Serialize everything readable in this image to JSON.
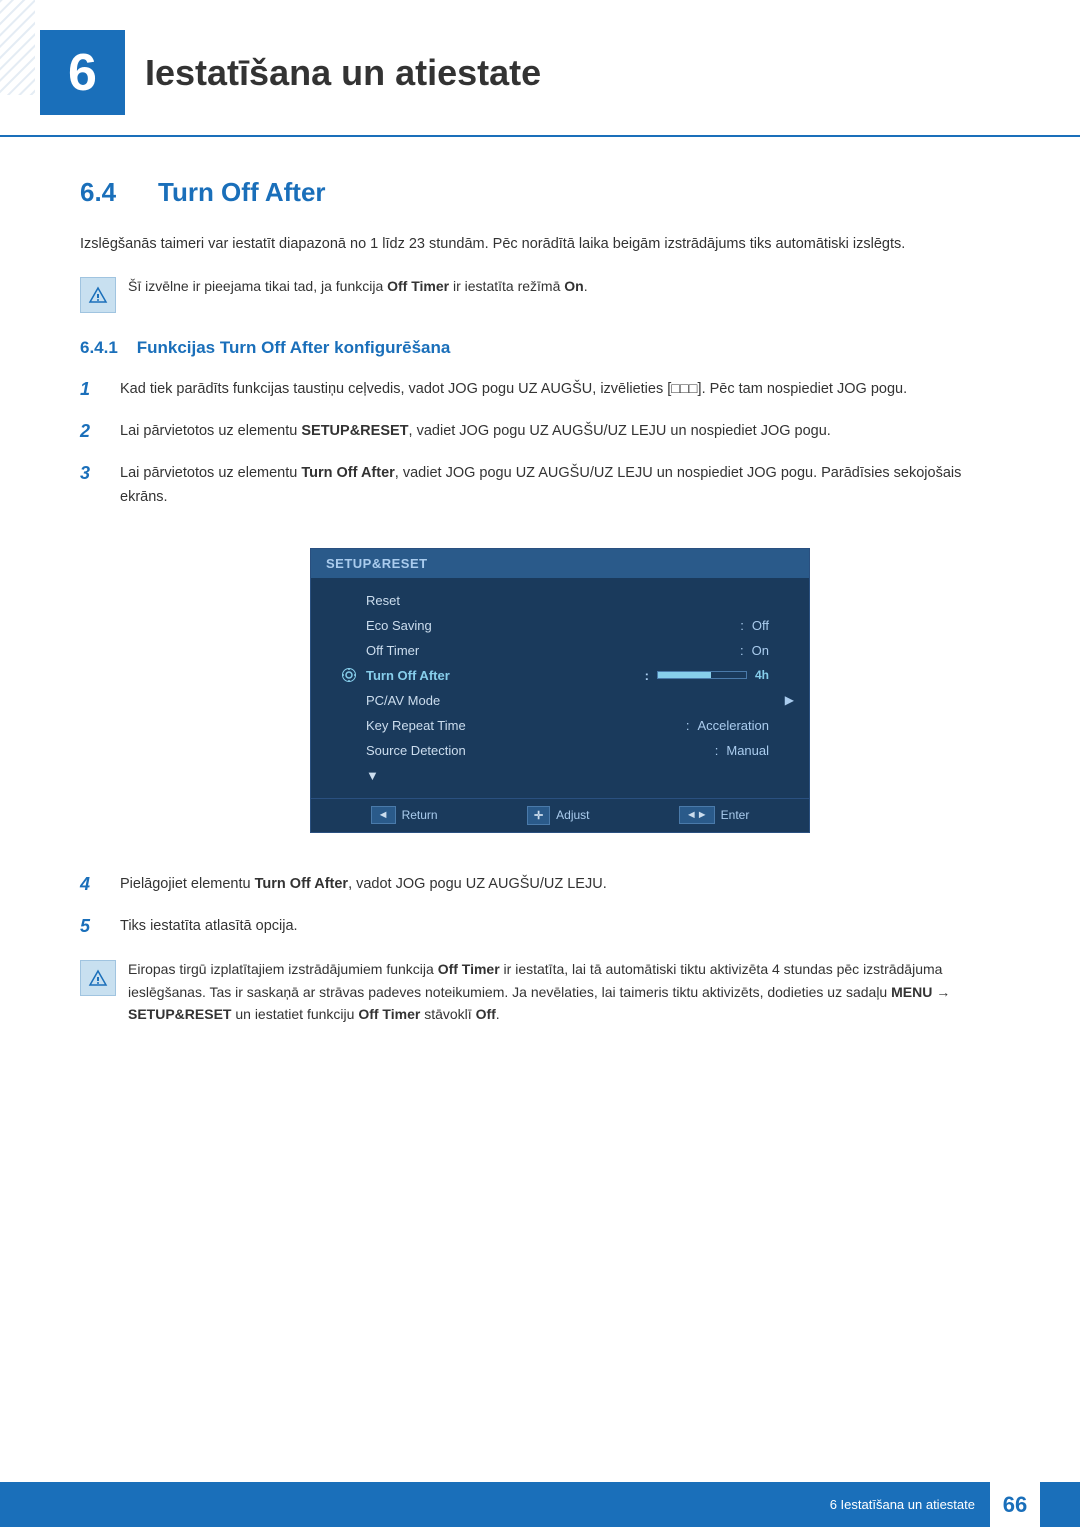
{
  "chapter": {
    "number": "6",
    "title": "Iestatīšana un atiestate"
  },
  "section": {
    "number": "6.4",
    "title": "Turn Off After"
  },
  "body_paragraph": "Izslēgšanās taimeri var iestatīt diapazonā no 1 līdz 23 stundām. Pēc norādītā laika beigām izstrādājums tiks automātiski izslēgts.",
  "note1": {
    "text": "Šī izvēlne ir pieejama tikai tad, ja funkcija Off Timer ir iestatīta režīmā On."
  },
  "subsection": {
    "number": "6.4.1",
    "title": "Funkcijas Turn Off After konfigurēšana"
  },
  "steps": [
    {
      "number": "1",
      "text_before": "Kad tiek parādīts funkcijas taustiņu ceļvedis, vadot JOG pogu UZ AUGŠU, izvēlieties [",
      "icon": "□□□",
      "text_after": "]. Pēc tam nospiediet JOG pogu."
    },
    {
      "number": "2",
      "text_plain": "Lai pārvietotos uz elementu ",
      "bold1": "SETUP&RESET",
      "text_mid": ", vadiet JOG pogu UZ AUGŠU/UZ LEJU un nospiediet JOG pogu."
    },
    {
      "number": "3",
      "text_plain": "Lai pārvietotos uz elementu ",
      "bold1": "Turn Off After",
      "text_mid": ", vadiet JOG pogu UZ AUGŠU/UZ LEJU un nospiediet JOG pogu. Parādīsies sekojošais ekrāns."
    },
    {
      "number": "4",
      "text_plain": "Pielāgojiet elementu ",
      "bold1": "Turn Off After",
      "text_mid": ", vadot JOG pogu UZ AUGŠU/UZ LEJU."
    },
    {
      "number": "5",
      "text_plain": "Tiks iestatīta atlasītā opcija."
    }
  ],
  "menu": {
    "title": "SETUP&RESET",
    "rows": [
      {
        "label": "Reset",
        "value": "",
        "highlighted": false
      },
      {
        "label": "Eco Saving",
        "value": "Off",
        "highlighted": false
      },
      {
        "label": "Off Timer",
        "value": "On",
        "highlighted": false
      },
      {
        "label": "Turn Off After",
        "value": "",
        "highlighted": true,
        "hasProgress": true,
        "progressVal": "4h"
      },
      {
        "label": "PC/AV Mode",
        "value": "",
        "highlighted": false,
        "hasArrow": true
      },
      {
        "label": "Key Repeat Time",
        "value": "Acceleration",
        "highlighted": false
      },
      {
        "label": "Source Detection",
        "value": "Manual",
        "highlighted": false
      },
      {
        "label": "...",
        "value": "",
        "highlighted": false,
        "isDots": true
      }
    ],
    "footer": [
      {
        "btn": "◄",
        "label": "Return"
      },
      {
        "btn": "✚",
        "label": "Adjust"
      },
      {
        "btn": "◄►",
        "label": "Enter"
      }
    ]
  },
  "note2": {
    "text1": "Eiropas tirgū izplatītajiem izstrādājumiem funkcija ",
    "bold1": "Off Timer",
    "text2": " ir iestatīta, lai tā automātiski tiktu aktivizēta 4 stundas pēc izstrādājuma ieslēgšanas. Tas ir saskaņā ar strāvas padeves noteikumiem. Ja nevēlaties, lai taimeris tiktu aktivizēts, dodieties uz sadaļu ",
    "bold2": "MENU",
    "arrow": " → ",
    "bold3": "SETUP&RESET",
    "text3": " un iestatiet funkciju ",
    "bold4": "Off Timer",
    "text4": " stāvoklī ",
    "bold5": "Off",
    "text5": "."
  },
  "footer": {
    "chapter_label": "6 Iestatīšana un atiestate",
    "page_number": "66"
  }
}
